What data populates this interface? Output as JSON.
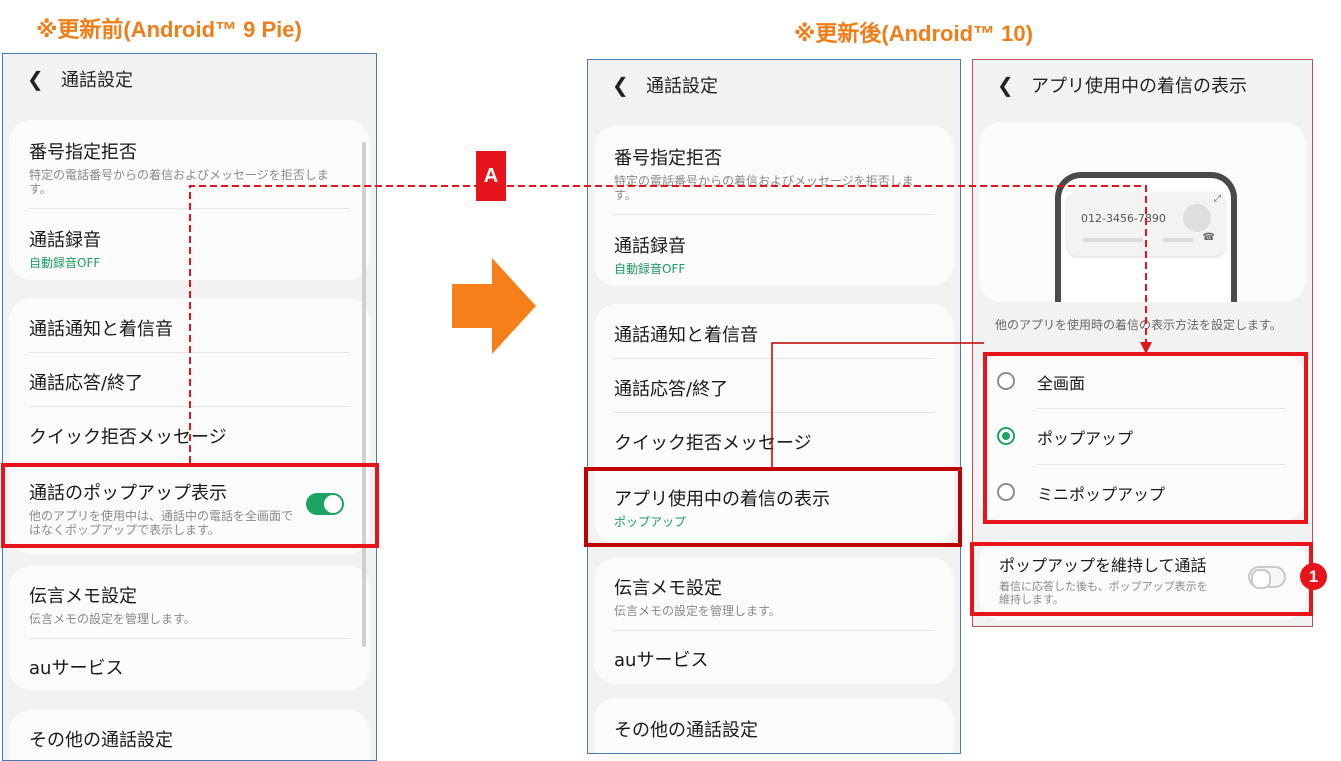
{
  "headings": {
    "before": "※更新前(Android™ 9 Pie)",
    "after": "※更新後(Android™ 10)"
  },
  "call_settings": {
    "back_icon": "chevron-left-icon",
    "title": "通話設定",
    "block_numbers": {
      "label": "番号指定拒否",
      "sub": "特定の電話番号からの着信およびメッセージを拒否します。"
    },
    "call_recording": {
      "label": "通話録音",
      "sub": "自動録音OFF"
    },
    "notifications": "通話通知と着信音",
    "answer_end": "通話応答/終了",
    "quick_decline": "クイック拒否メッセージ",
    "popup_display": {
      "label": "通話のポップアップ表示",
      "sub": "他のアプリを使用中は、通話中の電話を全画面ではなくポップアップで表示します。",
      "enabled": true
    },
    "incoming_in_app": {
      "label": "アプリ使用中の着信の表示",
      "sub": "ポップアップ"
    },
    "voicemail": {
      "label": "伝言メモ設定",
      "sub": "伝言メモの設定を管理します。"
    },
    "au_service": "auサービス",
    "other_settings": "その他の通話設定"
  },
  "incoming_display": {
    "title": "アプリ使用中の着信の表示",
    "preview_number": "012-3456-7890",
    "description": "他のアプリを使用時の着信の表示方法を設定します。",
    "options": [
      {
        "label": "全画面",
        "selected": false
      },
      {
        "label": "ポップアップ",
        "selected": true
      },
      {
        "label": "ミニポップアップ",
        "selected": false
      }
    ],
    "keep_popup": {
      "label": "ポップアップを維持して通話",
      "sub": "着信に応答した後も、ポップアップ表示を維持します。",
      "enabled": false
    }
  },
  "annotations": {
    "label_a": "A",
    "marker_1": "1"
  },
  "colors": {
    "heading": "#f07d17",
    "accent_green": "#1ea362",
    "highlight_red": "#e8141b",
    "highlight_dark_red": "#c00000",
    "frame_blue": "#4a7ab8"
  }
}
